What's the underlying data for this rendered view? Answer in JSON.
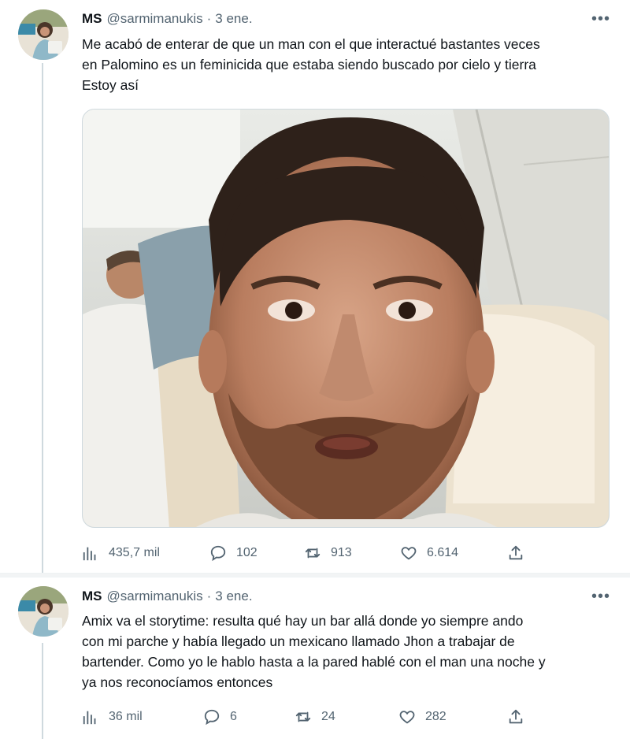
{
  "tweets": [
    {
      "author_name": "MS",
      "handle": "@sarmimanukis",
      "separator": "·",
      "date": "3 ene.",
      "more": "•••",
      "lines": [
        "Me acabó de enterar de que un man con el que interactué bastantes veces",
        "en Palomino es un feminicida que estaba siendo buscado por cielo y tierra",
        "Estoy así"
      ],
      "has_media": true,
      "stats": {
        "views": "435,7 mil",
        "replies": "102",
        "retweets": "913",
        "likes": "6.614"
      }
    },
    {
      "author_name": "MS",
      "handle": "@sarmimanukis",
      "separator": "·",
      "date": "3 ene.",
      "more": "•••",
      "lines": [
        "Amix va el storytime: resulta qué hay un bar allá donde yo siempre ando",
        "con mi parche y había llegado un mexicano llamado Jhon a trabajar de",
        "bartender. Como yo le hablo hasta a la pared hablé con el man una noche y",
        "ya nos reconocíamos entonces"
      ],
      "has_media": false,
      "stats": {
        "views": "36 mil",
        "replies": "6",
        "retweets": "24",
        "likes": "282"
      }
    }
  ],
  "icons": {
    "views": "bar-chart-icon",
    "reply": "speech-bubble-icon",
    "retweet": "retweet-arrows-icon",
    "like": "heart-icon",
    "share": "share-upload-icon"
  },
  "colors": {
    "text": "#0f1419",
    "secondary": "#536471",
    "thread_line": "#cfd9de",
    "divider": "#f2f4f5"
  }
}
